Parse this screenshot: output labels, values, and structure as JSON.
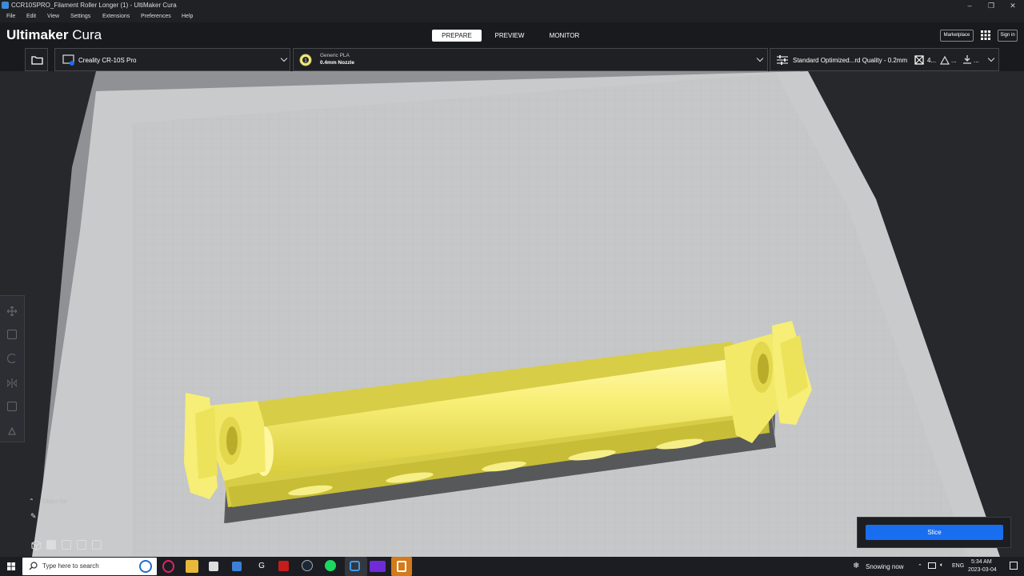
{
  "window": {
    "title": "CCR10SPRO_Filament Roller Longer (1) - UltiMaker Cura",
    "minimize": "–",
    "maximize": "❐",
    "close": "✕"
  },
  "menu": [
    "File",
    "Edit",
    "View",
    "Settings",
    "Extensions",
    "Preferences",
    "Help"
  ],
  "header": {
    "logo_bold": "Ultimaker",
    "logo_rest": " Cura",
    "stages": [
      "PREPARE",
      "PREVIEW",
      "MONITOR"
    ],
    "active_stage": "PREPARE",
    "marketplace": "Marketplace",
    "sign_in": "Sign in"
  },
  "printer": {
    "name": "Creality CR-10S Pro"
  },
  "material": {
    "name": "Generic PLA",
    "nozzle": "0.4mm Nozzle"
  },
  "print_settings": {
    "profile": "Standard Optimized...rd Quality - 0.2mm",
    "infill": "4...",
    "support": "...",
    "adhesion": "..."
  },
  "object_list": {
    "label": "Object list"
  },
  "slice": {
    "label": "Slice"
  },
  "taskbar": {
    "search_placeholder": "Type here to search",
    "weather": "Snowing now",
    "language": "ENG",
    "time": "5:34 AM",
    "date": "2023-03-04"
  },
  "colors": {
    "accent": "#196ef0",
    "model": "#f4ec6e",
    "build_plate": "#c9cacc"
  }
}
